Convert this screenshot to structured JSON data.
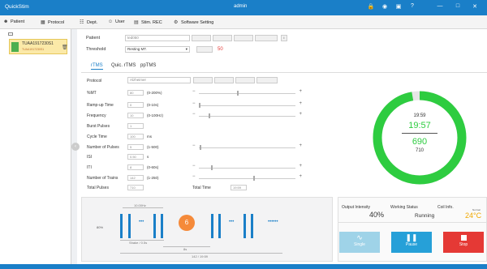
{
  "app": {
    "title": "QuickStim",
    "user": "admin"
  },
  "window_icons": [
    "lock-icon",
    "eye-icon",
    "record-icon",
    "help-icon",
    "minimize-icon",
    "maximize-icon",
    "close-icon"
  ],
  "menu": [
    {
      "label": "Patient",
      "icon": "patient-icon"
    },
    {
      "label": "Protocol",
      "icon": "protocol-icon"
    },
    {
      "label": "Dept.",
      "icon": "dept-icon"
    },
    {
      "label": "User",
      "icon": "user-icon"
    },
    {
      "label": "Stim. REC",
      "icon": "stim-rec-icon"
    },
    {
      "label": "Software Setting",
      "icon": "settings-icon"
    }
  ],
  "patient_card": {
    "name": "TUAA1917230S1",
    "id": "TUAA1917230S1"
  },
  "patient_row": {
    "label": "Patient",
    "value": "ted050",
    "buttons": [
      "",
      "",
      "",
      ""
    ]
  },
  "threshold_row": {
    "label": "Threshold",
    "value": "Resting MT.",
    "value2": "",
    "number": "50"
  },
  "tabs": [
    "rTMS",
    "Quic. rTMS",
    "ppTMS"
  ],
  "protocol_row": {
    "label": "Protocol",
    "value": "Alzheimer",
    "buttons": [
      "",
      "",
      "",
      ""
    ]
  },
  "params": [
    {
      "label": "%MT",
      "value": "80",
      "range": "(0-200%)",
      "knob": 0.4
    },
    {
      "label": "Ramp-up Time",
      "value": "0",
      "range": "(0-10s)",
      "knob": 0.0
    },
    {
      "label": "Frequency",
      "value": "10",
      "range": "(0-100Hz)",
      "knob": 0.1
    },
    {
      "label": "Burst Pulses",
      "value": "1",
      "range": "",
      "knob": null
    },
    {
      "label": "Cycle Time",
      "value": "100",
      "range": "ms",
      "knob": null
    },
    {
      "label": "Number of Pulses",
      "value": "5",
      "range": "(1-500)",
      "knob": 0.01
    },
    {
      "label": "ISI",
      "value": "0.50",
      "range": "s",
      "knob": null
    },
    {
      "label": "ITI",
      "value": "8",
      "range": "(0-60s)",
      "knob": 0.13
    },
    {
      "label": "Number of Trains",
      "value": "142",
      "range": "(1-250)",
      "knob": 0.57
    }
  ],
  "totals": {
    "pulses_label": "Total Pulses",
    "pulses_value": "710",
    "time_label": "Total Time",
    "time_value": "19:59"
  },
  "timer": {
    "total": "19:59",
    "remaining": "19:57",
    "pulses_remaining": "690",
    "pulses_total": "710",
    "progress": 0.972
  },
  "waveform": {
    "top_label": "10.00Hz",
    "side_label": "80%",
    "badge": "6",
    "ramp_label": "Shake / 0.5s",
    "iti_label": "8s",
    "train_label": "142 / 19:59",
    "dots": "•••",
    "dots_long": "••••••"
  },
  "status": {
    "output_label": "Output Intensity",
    "output_value": "40%",
    "working_label": "Working Status",
    "working_value": "Running",
    "coil_label": "Coil Info.",
    "coil_temp_label": "Normal",
    "coil_temp": "24°C"
  },
  "controls": [
    {
      "label": "Single",
      "icon": "single-pulse-icon",
      "color": "#9fd3e8"
    },
    {
      "label": "Pause",
      "icon": "pause-icon",
      "color": "#26a0d8"
    },
    {
      "label": "Stop",
      "icon": "stop-icon",
      "color": "#e53935"
    }
  ],
  "colors": {
    "accent": "#1a7fc8",
    "progress_ring": "#2ecc40",
    "highlight": "#fbe9a8"
  }
}
